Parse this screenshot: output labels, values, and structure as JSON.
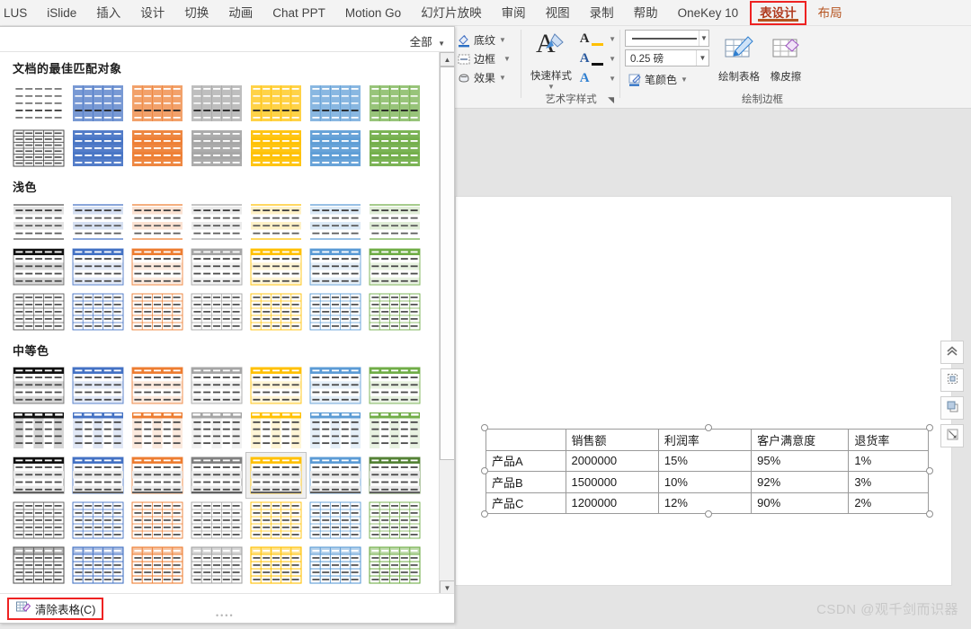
{
  "menubar": {
    "items": [
      {
        "label": "LUS",
        "type": "normal"
      },
      {
        "label": "iSlide",
        "type": "normal"
      },
      {
        "label": "插入",
        "type": "normal"
      },
      {
        "label": "设计",
        "type": "normal"
      },
      {
        "label": "切换",
        "type": "normal"
      },
      {
        "label": "动画",
        "type": "normal"
      },
      {
        "label": "Chat PPT",
        "type": "normal"
      },
      {
        "label": "Motion Go",
        "type": "normal"
      },
      {
        "label": "幻灯片放映",
        "type": "normal"
      },
      {
        "label": "审阅",
        "type": "normal"
      },
      {
        "label": "视图",
        "type": "normal"
      },
      {
        "label": "录制",
        "type": "normal"
      },
      {
        "label": "帮助",
        "type": "normal"
      },
      {
        "label": "OneKey 10",
        "type": "normal"
      },
      {
        "label": "表设计",
        "type": "active"
      },
      {
        "label": "布局",
        "type": "sub"
      }
    ]
  },
  "ribbon": {
    "fill_group": {
      "shading_label": "底纹",
      "border_label": "边框",
      "effects_label": "效果"
    },
    "wordart_group": {
      "quick_style_label": "快速样式",
      "group_label": "艺术字样式"
    },
    "draw_group": {
      "line_style_value": "",
      "line_weight_value": "0.25 磅",
      "pen_color_label": "笔颜色",
      "draw_table_label": "绘制表格",
      "eraser_label": "橡皮擦",
      "group_label": "绘制边框"
    }
  },
  "gallery": {
    "filter_label": "全部",
    "sections": [
      {
        "title": "文档的最佳匹配对象",
        "rows": [
          {
            "style": "plain-dashed",
            "cells": [
              {
                "accent": "none",
                "variant": "nogrid"
              },
              {
                "accent": "#4472C4",
                "variant": "filled-col"
              },
              {
                "accent": "#ED7D31",
                "variant": "filled-col"
              },
              {
                "accent": "#A5A5A5",
                "variant": "filled-col"
              },
              {
                "accent": "#FFC000",
                "variant": "filled-col"
              },
              {
                "accent": "#5B9BD5",
                "variant": "filled-col"
              },
              {
                "accent": "#70AD47",
                "variant": "filled-col"
              }
            ]
          },
          {
            "style": "gridded",
            "cells": [
              {
                "accent": "none",
                "variant": "grid-outline"
              },
              {
                "accent": "#4472C4",
                "variant": "filled-row"
              },
              {
                "accent": "#ED7D31",
                "variant": "filled-row"
              },
              {
                "accent": "#A5A5A5",
                "variant": "filled-row"
              },
              {
                "accent": "#FFC000",
                "variant": "filled-row"
              },
              {
                "accent": "#5B9BD5",
                "variant": "filled-row"
              },
              {
                "accent": "#70AD47",
                "variant": "filled-row"
              }
            ]
          }
        ]
      },
      {
        "title": "浅色",
        "rows": [
          {
            "style": "light-banded",
            "cells": [
              {
                "accent": "#7F7F7F",
                "variant": "light-band"
              },
              {
                "accent": "#4472C4",
                "variant": "light-band"
              },
              {
                "accent": "#ED7D31",
                "variant": "light-band"
              },
              {
                "accent": "#A5A5A5",
                "variant": "light-band"
              },
              {
                "accent": "#FFC000",
                "variant": "light-band"
              },
              {
                "accent": "#5B9BD5",
                "variant": "light-band"
              },
              {
                "accent": "#70AD47",
                "variant": "light-band"
              }
            ]
          },
          {
            "style": "light-header",
            "cells": [
              {
                "accent": "#000000",
                "variant": "head-band"
              },
              {
                "accent": "#4472C4",
                "variant": "head-band"
              },
              {
                "accent": "#ED7D31",
                "variant": "head-band"
              },
              {
                "accent": "#A5A5A5",
                "variant": "head-band"
              },
              {
                "accent": "#FFC000",
                "variant": "head-band"
              },
              {
                "accent": "#5B9BD5",
                "variant": "head-band"
              },
              {
                "accent": "#70AD47",
                "variant": "head-band"
              }
            ]
          },
          {
            "style": "light-grid",
            "cells": [
              {
                "accent": "#595959",
                "variant": "light-grid"
              },
              {
                "accent": "#4472C4",
                "variant": "light-grid"
              },
              {
                "accent": "#ED7D31",
                "variant": "light-grid"
              },
              {
                "accent": "#A5A5A5",
                "variant": "light-grid"
              },
              {
                "accent": "#FFC000",
                "variant": "light-grid"
              },
              {
                "accent": "#5B9BD5",
                "variant": "light-grid"
              },
              {
                "accent": "#70AD47",
                "variant": "light-grid"
              }
            ]
          }
        ]
      },
      {
        "title": "中等色",
        "rows": [
          {
            "style": "medium-head-rows",
            "cells": [
              {
                "accent": "#000000",
                "variant": "head-band"
              },
              {
                "accent": "#4472C4",
                "variant": "head-band"
              },
              {
                "accent": "#ED7D31",
                "variant": "head-band"
              },
              {
                "accent": "#A5A5A5",
                "variant": "head-band"
              },
              {
                "accent": "#FFC000",
                "variant": "head-band"
              },
              {
                "accent": "#5B9BD5",
                "variant": "head-band"
              },
              {
                "accent": "#70AD47",
                "variant": "head-band"
              }
            ]
          },
          {
            "style": "medium-col",
            "cells": [
              {
                "accent": "#000000",
                "variant": "col-band"
              },
              {
                "accent": "#4472C4",
                "variant": "col-band"
              },
              {
                "accent": "#ED7D31",
                "variant": "col-band"
              },
              {
                "accent": "#A5A5A5",
                "variant": "col-band"
              },
              {
                "accent": "#FFC000",
                "variant": "col-band"
              },
              {
                "accent": "#5B9BD5",
                "variant": "col-band"
              },
              {
                "accent": "#70AD47",
                "variant": "col-band"
              }
            ]
          },
          {
            "style": "medium-dark-head",
            "cells": [
              {
                "accent": "#000000",
                "variant": "dark-head"
              },
              {
                "accent": "#4472C4",
                "variant": "dark-head"
              },
              {
                "accent": "#ED7D31",
                "variant": "dark-head"
              },
              {
                "accent": "#808080",
                "variant": "dark-head"
              },
              {
                "accent": "#FFC000",
                "variant": "dark-head",
                "selected": true
              },
              {
                "accent": "#5B9BD5",
                "variant": "dark-head"
              },
              {
                "accent": "#548235",
                "variant": "dark-head"
              }
            ]
          },
          {
            "style": "medium-grid",
            "cells": [
              {
                "accent": "#595959",
                "variant": "light-grid"
              },
              {
                "accent": "#4472C4",
                "variant": "light-grid"
              },
              {
                "accent": "#ED7D31",
                "variant": "light-grid"
              },
              {
                "accent": "#A5A5A5",
                "variant": "light-grid"
              },
              {
                "accent": "#FFC000",
                "variant": "light-grid"
              },
              {
                "accent": "#5B9BD5",
                "variant": "light-grid"
              },
              {
                "accent": "#70AD47",
                "variant": "light-grid"
              }
            ]
          },
          {
            "style": "medium-grid-2",
            "cells": [
              {
                "accent": "#595959",
                "variant": "grid-bold"
              },
              {
                "accent": "#4472C4",
                "variant": "grid-bold"
              },
              {
                "accent": "#ED7D31",
                "variant": "grid-bold"
              },
              {
                "accent": "#A5A5A5",
                "variant": "grid-bold"
              },
              {
                "accent": "#FFC000",
                "variant": "grid-bold"
              },
              {
                "accent": "#5B9BD5",
                "variant": "grid-bold"
              },
              {
                "accent": "#70AD47",
                "variant": "grid-bold"
              }
            ]
          }
        ]
      }
    ],
    "clear_table_label": "清除表格(C)"
  },
  "slide_table": {
    "headers": [
      "",
      "销售额",
      "利润率",
      "客户满意度",
      "退货率"
    ],
    "rows": [
      [
        "产品A",
        "2000000",
        "15%",
        "95%",
        "1%"
      ],
      [
        "产品B",
        "1500000",
        "10%",
        "92%",
        "3%"
      ],
      [
        "产品C",
        "1200000",
        "12%",
        "90%",
        "2%"
      ]
    ]
  },
  "float_buttons": [
    {
      "name": "collapse-up"
    },
    {
      "name": "layout-options"
    },
    {
      "name": "arrange-front"
    },
    {
      "name": "size-position"
    }
  ],
  "watermark": "CSDN @观千剑而识器"
}
